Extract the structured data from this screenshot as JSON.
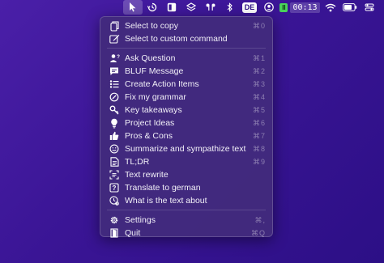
{
  "menubar": {
    "input_badge": "DE",
    "timer": "00:13",
    "timer_state": "II",
    "icons": [
      "cursor-icon",
      "history-icon",
      "window-icon",
      "layers-icon",
      "airpods-icon",
      "bluetooth-icon",
      "input-source-icon",
      "user-icon",
      "timer-icon",
      "wifi-icon",
      "battery-icon",
      "control-center-icon"
    ]
  },
  "menu": {
    "group1": [
      {
        "label": "Select to copy",
        "shortcut": "⌘0",
        "icon": "copy-icon"
      },
      {
        "label": "Select to custom command",
        "shortcut": "",
        "icon": "edit-icon"
      }
    ],
    "group2": [
      {
        "label": "Ask Question",
        "shortcut": "⌘1",
        "icon": "person-question-icon"
      },
      {
        "label": "BLUF Message",
        "shortcut": "⌘2",
        "icon": "message-icon"
      },
      {
        "label": "Create Action Items",
        "shortcut": "⌘3",
        "icon": "checklist-icon"
      },
      {
        "label": "Fix my grammar",
        "shortcut": "⌘4",
        "icon": "circle-slash-icon"
      },
      {
        "label": "Key takeaways",
        "shortcut": "⌘5",
        "icon": "key-icon"
      },
      {
        "label": "Project Ideas",
        "shortcut": "⌘6",
        "icon": "lightbulb-icon"
      },
      {
        "label": "Pros & Cons",
        "shortcut": "⌘7",
        "icon": "thumbs-up-icon"
      },
      {
        "label": "Summarize and sympathize text",
        "shortcut": "⌘8",
        "icon": "smile-icon"
      },
      {
        "label": "TL;DR",
        "shortcut": "⌘9",
        "icon": "document-icon"
      },
      {
        "label": "Text rewrite",
        "shortcut": "",
        "icon": "text-scan-icon"
      },
      {
        "label": "Translate to german",
        "shortcut": "",
        "icon": "question-square-icon"
      },
      {
        "label": "What is the text about",
        "shortcut": "",
        "icon": "clock-question-icon"
      }
    ],
    "group3": [
      {
        "label": "Settings",
        "shortcut": "⌘,",
        "icon": "gear-icon"
      },
      {
        "label": "Quit",
        "shortcut": "⌘Q",
        "icon": "exit-icon"
      }
    ]
  },
  "colors": {
    "background": "#3a1595",
    "menu": "#422a7c",
    "timer_green": "#49d35a"
  }
}
